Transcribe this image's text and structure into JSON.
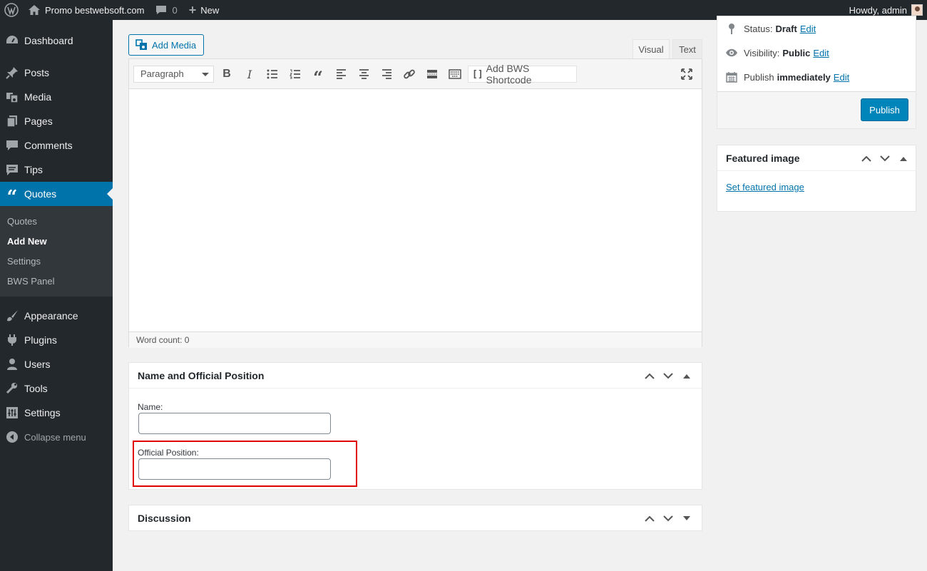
{
  "adminbar": {
    "site_name": "Promo bestwebsoft.com",
    "comments_count": "0",
    "new_label": "New",
    "howdy": "Howdy, admin"
  },
  "sidebar": {
    "items": [
      {
        "label": "Dashboard",
        "icon": "dashboard-icon"
      },
      {
        "label": "Posts",
        "icon": "pin-icon"
      },
      {
        "label": "Media",
        "icon": "media-icon"
      },
      {
        "label": "Pages",
        "icon": "pages-icon"
      },
      {
        "label": "Comments",
        "icon": "comment-icon"
      },
      {
        "label": "Tips",
        "icon": "tips-icon"
      },
      {
        "label": "Quotes",
        "icon": "quote-icon"
      }
    ],
    "submenu": [
      "Quotes",
      "Add New",
      "Settings",
      "BWS Panel"
    ],
    "items_after": [
      {
        "label": "Appearance",
        "icon": "brush-icon"
      },
      {
        "label": "Plugins",
        "icon": "plugin-icon"
      },
      {
        "label": "Users",
        "icon": "user-icon"
      },
      {
        "label": "Tools",
        "icon": "wrench-icon"
      },
      {
        "label": "Settings",
        "icon": "settings-icon"
      }
    ],
    "collapse": "Collapse menu"
  },
  "editor": {
    "add_media": "Add Media",
    "tab_visual": "Visual",
    "tab_text": "Text",
    "format_select": "Paragraph",
    "shortcode_label": "Add BWS Shortcode",
    "word_count": "Word count: 0"
  },
  "name_box": {
    "title": "Name and Official Position",
    "name_label": "Name:",
    "position_label": "Official Position:"
  },
  "discussion": {
    "title": "Discussion"
  },
  "publish": {
    "status_label": "Status:",
    "status_value": "Draft",
    "visibility_label": "Visibility:",
    "visibility_value": "Public",
    "publish_label": "Publish",
    "publish_value": "immediately",
    "edit": "Edit",
    "publish_button": "Publish"
  },
  "featured": {
    "title": "Featured image",
    "link": "Set featured image"
  },
  "colors": {
    "accent": "#0073aa",
    "sidebar": "#23282d",
    "highlight": "#e00000"
  }
}
